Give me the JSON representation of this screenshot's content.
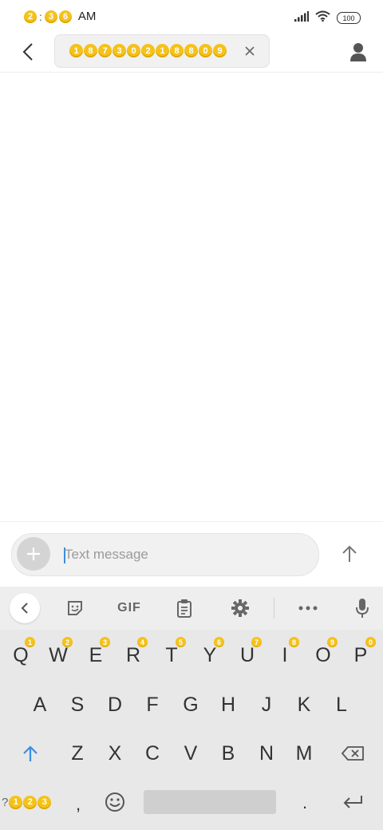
{
  "status_bar": {
    "time_h": "2",
    "time_m1": "3",
    "time_m2": "6",
    "ampm": "AM",
    "battery": "100"
  },
  "header": {
    "recipient_digits": [
      "1",
      "8",
      "7",
      "3",
      "0",
      "2",
      "1",
      "8",
      "8",
      "0",
      "9"
    ]
  },
  "compose": {
    "placeholder": "Text message",
    "value": ""
  },
  "keyboard": {
    "toolbar": {
      "gif_label": "GIF"
    },
    "row1": [
      "Q",
      "W",
      "E",
      "R",
      "T",
      "Y",
      "U",
      "I",
      "O",
      "P"
    ],
    "row1_hints": [
      "1",
      "2",
      "3",
      "4",
      "5",
      "6",
      "7",
      "8",
      "9",
      "0"
    ],
    "row2": [
      "A",
      "S",
      "D",
      "F",
      "G",
      "H",
      "J",
      "K",
      "L"
    ],
    "row3": [
      "Z",
      "X",
      "C",
      "V",
      "B",
      "N",
      "M"
    ],
    "symbols_prefix": "?",
    "symbols_digits": [
      "1",
      "2",
      "3"
    ],
    "comma": ",",
    "period": "."
  },
  "colors": {
    "accent": "#3b8ee0",
    "coin": "#f5c21b",
    "keyboard_bg": "#e8e8e8"
  }
}
